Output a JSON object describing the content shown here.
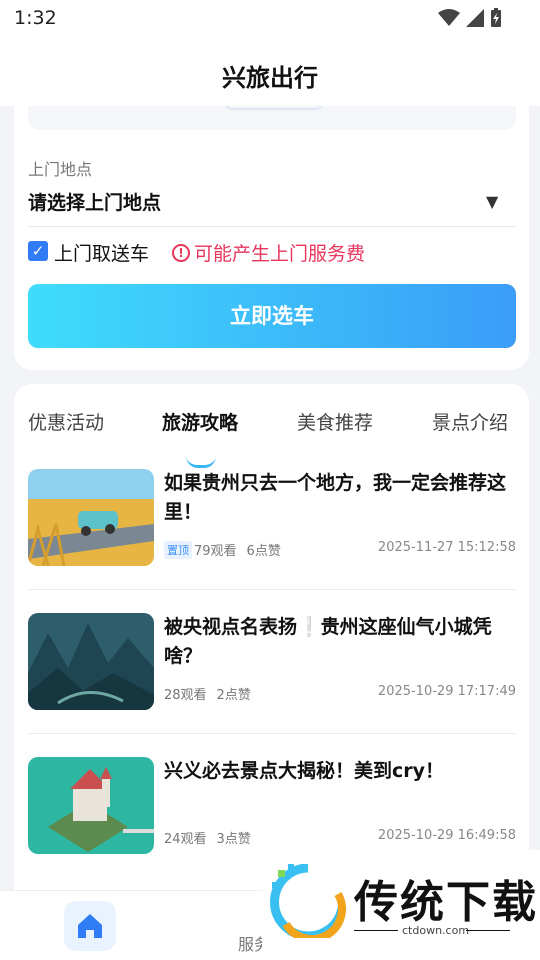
{
  "status_bar": {
    "time": "1:32"
  },
  "header": {
    "title": "兴旅出行"
  },
  "booking": {
    "location_label": "上门地点",
    "location_value": "请选择上门地点",
    "pickup_label": "上门取送车",
    "pickup_checked": true,
    "fee_notice": "可能产生上门服务费",
    "select_button": "立即选车"
  },
  "tabs": [
    {
      "label": "优惠活动",
      "active": false
    },
    {
      "label": "旅游攻略",
      "active": true
    },
    {
      "label": "美食推荐",
      "active": false
    },
    {
      "label": "景点介绍",
      "active": false
    }
  ],
  "articles": [
    {
      "title": "如果贵州只去一个地方，我一定会推荐这里！",
      "pinned": "置顶",
      "views": "79观看",
      "likes": "6点赞",
      "date": "2025-11-27 15:12:58"
    },
    {
      "title": "被央视点名表扬❕贵州这座仙气小城凭啥？",
      "views": "28观看",
      "likes": "2点赞",
      "date": "2025-10-29 17:17:49"
    },
    {
      "title": "兴义必去景点大揭秘！美到cry！",
      "views": "24观看",
      "likes": "3点赞",
      "date": "2025-10-29 16:49:58"
    }
  ],
  "bottom_nav": {
    "item2_label": "服务"
  },
  "watermark": {
    "text": "传统下载",
    "url": "ctdown.com"
  },
  "colors": {
    "accent": "#3a9df8",
    "warning": "#e8365d",
    "checkbox": "#2f7cf6"
  }
}
